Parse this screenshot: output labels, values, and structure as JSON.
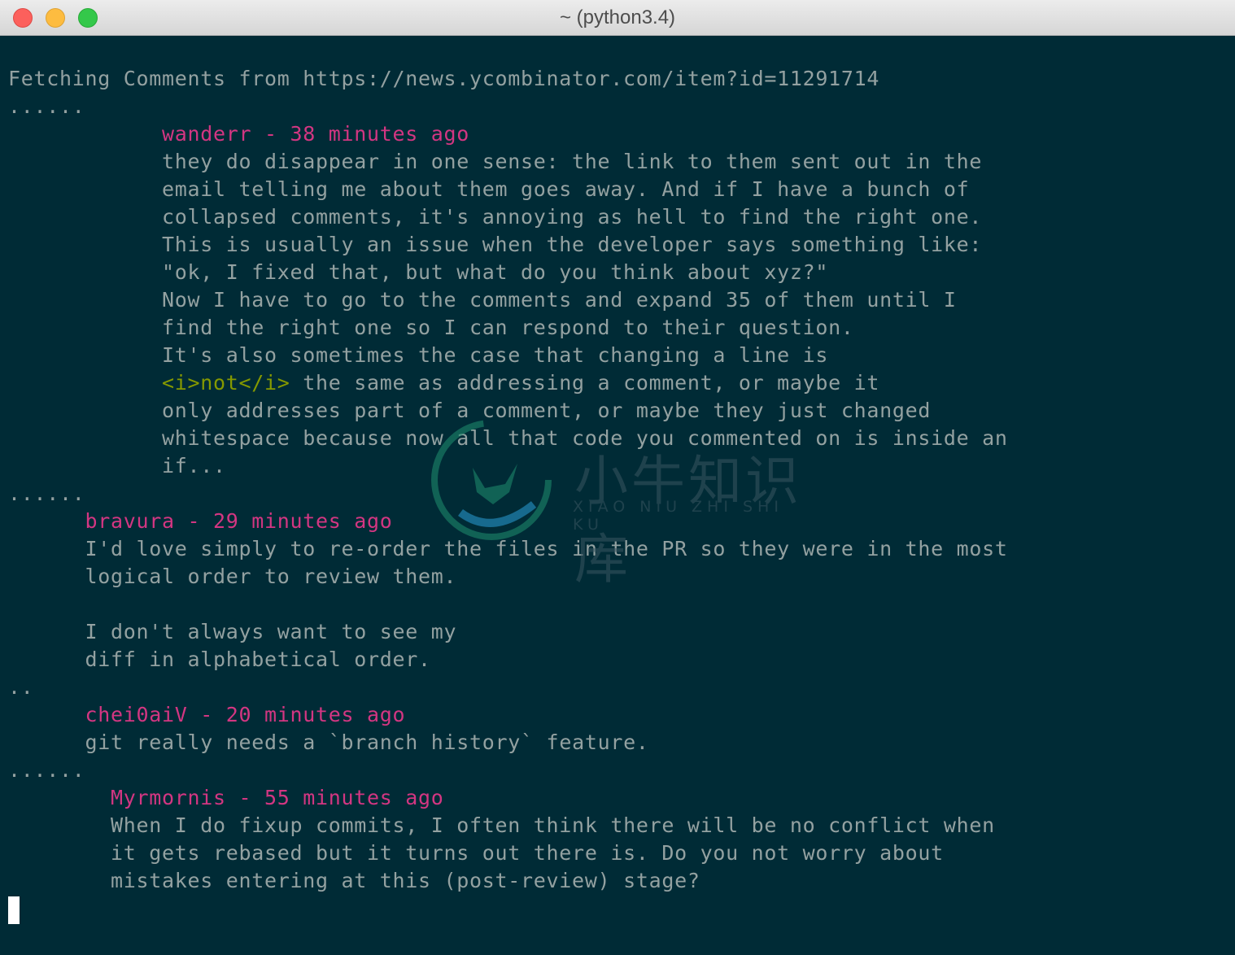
{
  "window": {
    "title": "~ (python3.4)"
  },
  "terminal": {
    "lines": [
      {
        "indent": "",
        "segments": [
          {
            "t": "Fetching Comments from https://news.ycombinator.com/item?id=11291714",
            "c": "text"
          }
        ]
      },
      {
        "indent": "",
        "segments": [
          {
            "t": "......",
            "c": "dots"
          }
        ]
      },
      {
        "indent": "            ",
        "segments": [
          {
            "t": "wanderr - 38 minutes ago",
            "c": "author"
          }
        ]
      },
      {
        "indent": "            ",
        "segments": [
          {
            "t": "they do disappear in one sense: the link to them sent out in the",
            "c": "text"
          }
        ]
      },
      {
        "indent": "            ",
        "segments": [
          {
            "t": "email telling me about them goes away. And if I have a bunch of",
            "c": "text"
          }
        ]
      },
      {
        "indent": "            ",
        "segments": [
          {
            "t": "collapsed comments, it's annoying as hell to find the right one.",
            "c": "text"
          }
        ]
      },
      {
        "indent": "            ",
        "segments": [
          {
            "t": "This is usually an issue when the developer says something like:",
            "c": "text"
          }
        ]
      },
      {
        "indent": "            ",
        "segments": [
          {
            "t": "\"ok, I fixed that, but what do you think about xyz?\"",
            "c": "text"
          }
        ]
      },
      {
        "indent": "            ",
        "segments": [
          {
            "t": "Now I have to go to the comments and expand 35 of them until I",
            "c": "text"
          }
        ]
      },
      {
        "indent": "            ",
        "segments": [
          {
            "t": "find the right one so I can respond to their question.",
            "c": "text"
          }
        ]
      },
      {
        "indent": "            ",
        "segments": [
          {
            "t": "It's also sometimes the case that changing a line is",
            "c": "text"
          }
        ]
      },
      {
        "indent": "            ",
        "segments": [
          {
            "t": "<i>not</i>",
            "c": "tag"
          },
          {
            "t": " the same as addressing a comment, or maybe it",
            "c": "text"
          }
        ]
      },
      {
        "indent": "            ",
        "segments": [
          {
            "t": "only addresses part of a comment, or maybe they just changed",
            "c": "text"
          }
        ]
      },
      {
        "indent": "            ",
        "segments": [
          {
            "t": "whitespace because now all that code you commented on is inside an",
            "c": "text"
          }
        ]
      },
      {
        "indent": "            ",
        "segments": [
          {
            "t": "if...",
            "c": "text"
          }
        ]
      },
      {
        "indent": "",
        "segments": [
          {
            "t": "......",
            "c": "dots"
          }
        ]
      },
      {
        "indent": "      ",
        "segments": [
          {
            "t": "bravura - 29 minutes ago",
            "c": "author"
          }
        ]
      },
      {
        "indent": "      ",
        "segments": [
          {
            "t": "I'd love simply to re-order the files in the PR so they were in the most",
            "c": "text"
          }
        ]
      },
      {
        "indent": "      ",
        "segments": [
          {
            "t": "logical order to review them.",
            "c": "text"
          }
        ]
      },
      {
        "indent": "",
        "segments": [
          {
            "t": "",
            "c": "text"
          }
        ]
      },
      {
        "indent": "      ",
        "segments": [
          {
            "t": "I don't always want to see my",
            "c": "text"
          }
        ]
      },
      {
        "indent": "      ",
        "segments": [
          {
            "t": "diff in alphabetical order.",
            "c": "text"
          }
        ]
      },
      {
        "indent": "",
        "segments": [
          {
            "t": "..",
            "c": "dots"
          }
        ]
      },
      {
        "indent": "      ",
        "segments": [
          {
            "t": "chei0aiV - 20 minutes ago",
            "c": "author"
          }
        ]
      },
      {
        "indent": "      ",
        "segments": [
          {
            "t": "git really needs a `branch history` feature.",
            "c": "text"
          }
        ]
      },
      {
        "indent": "",
        "segments": [
          {
            "t": "......",
            "c": "dots"
          }
        ]
      },
      {
        "indent": "        ",
        "segments": [
          {
            "t": "Myrmornis - 55 minutes ago",
            "c": "author"
          }
        ]
      },
      {
        "indent": "        ",
        "segments": [
          {
            "t": "When I do fixup commits, I often think there will be no conflict when",
            "c": "text"
          }
        ]
      },
      {
        "indent": "        ",
        "segments": [
          {
            "t": "it gets rebased but it turns out there is. Do you not worry about",
            "c": "text"
          }
        ]
      },
      {
        "indent": "        ",
        "segments": [
          {
            "t": "mistakes entering at this (post-review) stage?",
            "c": "text"
          }
        ]
      }
    ]
  },
  "watermark": {
    "title": "小牛知识库",
    "subtitle": "XIAO NIU ZHI SHI KU"
  },
  "colors": {
    "background": "#002b36",
    "text": "#93a1a1",
    "author": "#d33682",
    "tag": "#859900"
  }
}
